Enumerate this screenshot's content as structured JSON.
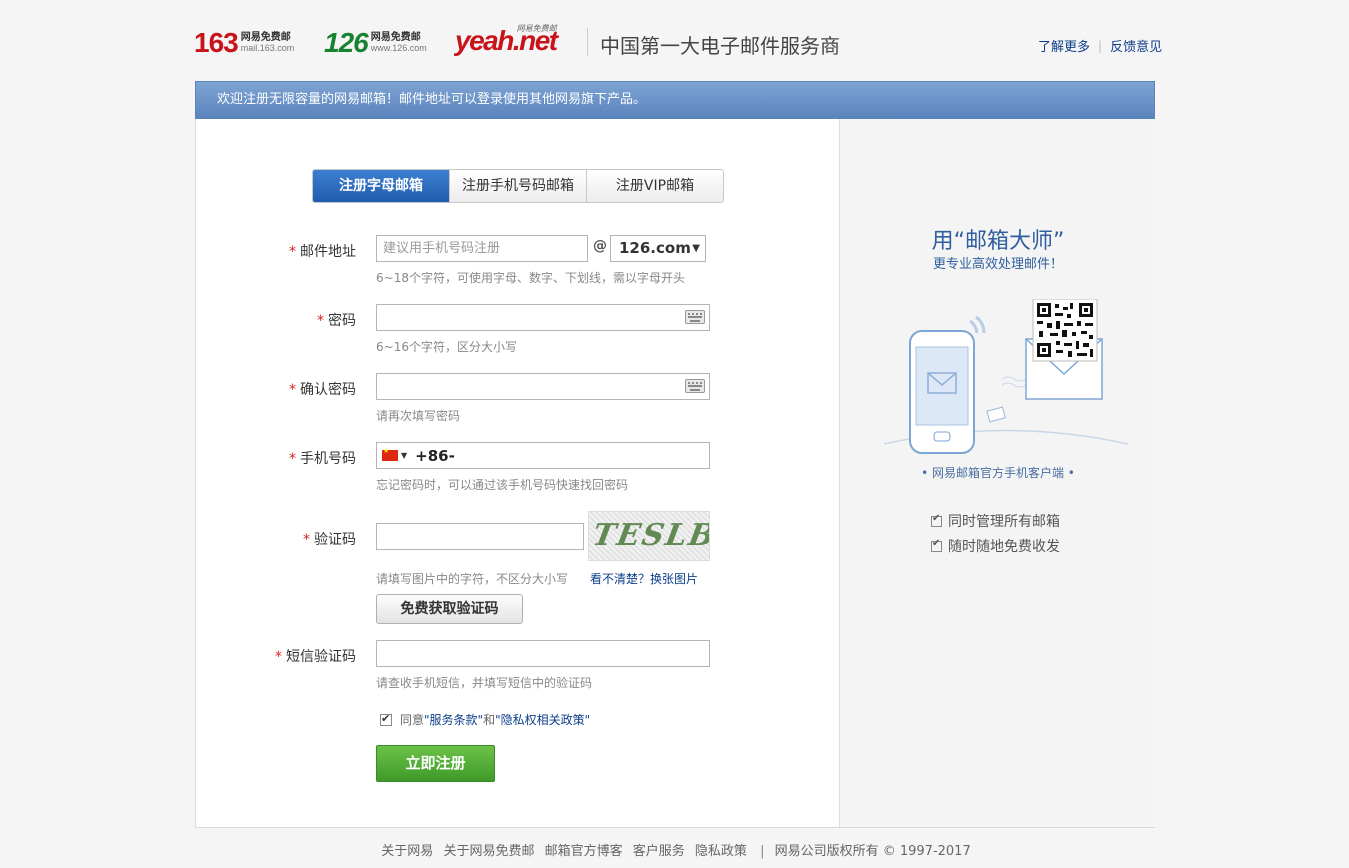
{
  "header": {
    "logo_163": {
      "big": "163",
      "cn": "网易免费邮",
      "url": "mail.163.com"
    },
    "logo_126": {
      "big": "126",
      "cn": "网易免费邮",
      "url": "www.126.com"
    },
    "logo_yeah": {
      "big": "yeah.net",
      "tag": "网易免费邮"
    },
    "slogan": "中国第一大电子邮件服务商",
    "links": {
      "learn_more": "了解更多",
      "separator": "|",
      "feedback": "反馈意见"
    }
  },
  "banner": {
    "text": "欢迎注册无限容量的网易邮箱！邮件地址可以登录使用其他网易旗下产品。"
  },
  "tabs": [
    {
      "label": "注册字母邮箱",
      "active": true
    },
    {
      "label": "注册手机号码邮箱",
      "active": false
    },
    {
      "label": "注册VIP邮箱",
      "active": false
    }
  ],
  "form": {
    "required_mark": "*",
    "email": {
      "label": "邮件地址",
      "placeholder": "建议用手机号码注册",
      "at": "@",
      "domain": "126.com",
      "domain_arrow": "▼",
      "hint": "6~18个字符，可使用字母、数字、下划线，需以字母开头"
    },
    "password": {
      "label": "密码",
      "hint": "6~16个字符，区分大小写"
    },
    "confirm_password": {
      "label": "确认密码",
      "hint": "请再次填写密码"
    },
    "phone": {
      "label": "手机号码",
      "flag_arrow": "▼",
      "prefix": "+86-",
      "hint": "忘记密码时，可以通过该手机号码快速找回密码"
    },
    "captcha": {
      "label": "验证码",
      "image_text": "TESLB",
      "hint": "请填写图片中的字符，不区分大小写",
      "refresh_link": "看不清楚？换张图片",
      "get_code_button": "免费获取验证码"
    },
    "sms_code": {
      "label": "短信验证码",
      "hint": "请查收手机短信，并填写短信中的验证码"
    },
    "agree": {
      "prefix": "同意",
      "terms": "\"服务条款\"",
      "and": "和",
      "privacy": "\"隐私权相关政策\"",
      "checked": true
    },
    "submit_button": "立即注册"
  },
  "promo": {
    "title": "用“邮箱大师”",
    "subtitle": "更专业高效处理邮件！",
    "client_label": "• 网易邮箱官方手机客户端 •",
    "features": [
      "同时管理所有邮箱",
      "随时随地免费收发"
    ]
  },
  "footer": {
    "links": [
      "关于网易",
      "关于网易免费邮",
      "邮箱官方博客",
      "客户服务",
      "隐私政策"
    ],
    "separator": "|",
    "copyright": "网易公司版权所有 © 1997-2017"
  },
  "colors": {
    "accent_blue": "#1e5dad",
    "banner": "#6b93c9",
    "green": "#3f9a29",
    "red_logo": "#c8131b",
    "green_logo": "#178330"
  },
  "icons": [
    "keyboard-icon",
    "china-flag-icon",
    "checkbox-icon",
    "phone-illustration",
    "qr-code"
  ]
}
